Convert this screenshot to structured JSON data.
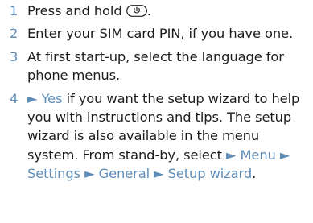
{
  "steps": [
    {
      "number": "1",
      "text_before": "Press and hold",
      "key_icon": "power-key-icon",
      "text_after": "."
    },
    {
      "number": "2",
      "text": "Enter your SIM card PIN, if you have one."
    },
    {
      "number": "3",
      "text": "At first start-up, select the language for phone menus."
    },
    {
      "number": "4",
      "arrow": "►",
      "yes": "Yes",
      "text_a": "if you want the setup wizard to help you with instructions and tips. The setup wizard is also available in the menu system. From stand-by, select",
      "menu": "Menu",
      "settings": "Settings",
      "general": "General",
      "setup_wizard": "Setup wizard",
      "end": "."
    }
  ],
  "colors": {
    "accent": "#5e8db8",
    "text": "#1c1c1c"
  }
}
